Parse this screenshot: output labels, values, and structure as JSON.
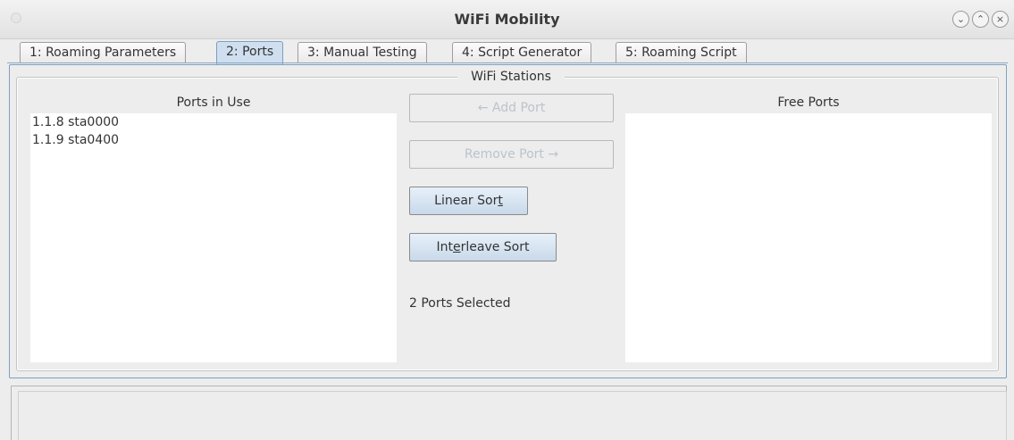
{
  "window": {
    "title": "WiFi Mobility",
    "controls": [
      {
        "name": "minimize",
        "glyph": "⌄"
      },
      {
        "name": "maximize",
        "glyph": "⌃"
      },
      {
        "name": "close",
        "glyph": "×"
      }
    ]
  },
  "tabs": [
    {
      "label": "1: Roaming Parameters",
      "active": false
    },
    {
      "label": "2: Ports",
      "active": true
    },
    {
      "label": "3: Manual Testing",
      "active": false
    },
    {
      "label": "4: Script Generator",
      "active": false
    },
    {
      "label": "5: Roaming Script",
      "active": false
    }
  ],
  "stations_panel": {
    "title": "WiFi Stations",
    "ports_in_use": {
      "header": "Ports in Use",
      "items": [
        "1.1.8 sta0000",
        "1.1.9 sta0400"
      ]
    },
    "free_ports": {
      "header": "Free Ports",
      "items": []
    },
    "buttons": {
      "add_port": "← Add Port",
      "remove_port": "Remove Port →",
      "linear_sort_pre": "Linear Sor",
      "linear_sort_mnemonic": "t",
      "interleave_sort_pre": "Int",
      "interleave_sort_mnemonic": "e",
      "interleave_sort_post": "rleave Sort"
    },
    "status": "2 Ports Selected"
  },
  "colors": {
    "tab_active": "#cfdff0",
    "button": "#c8d9ea",
    "background": "#ededed"
  }
}
